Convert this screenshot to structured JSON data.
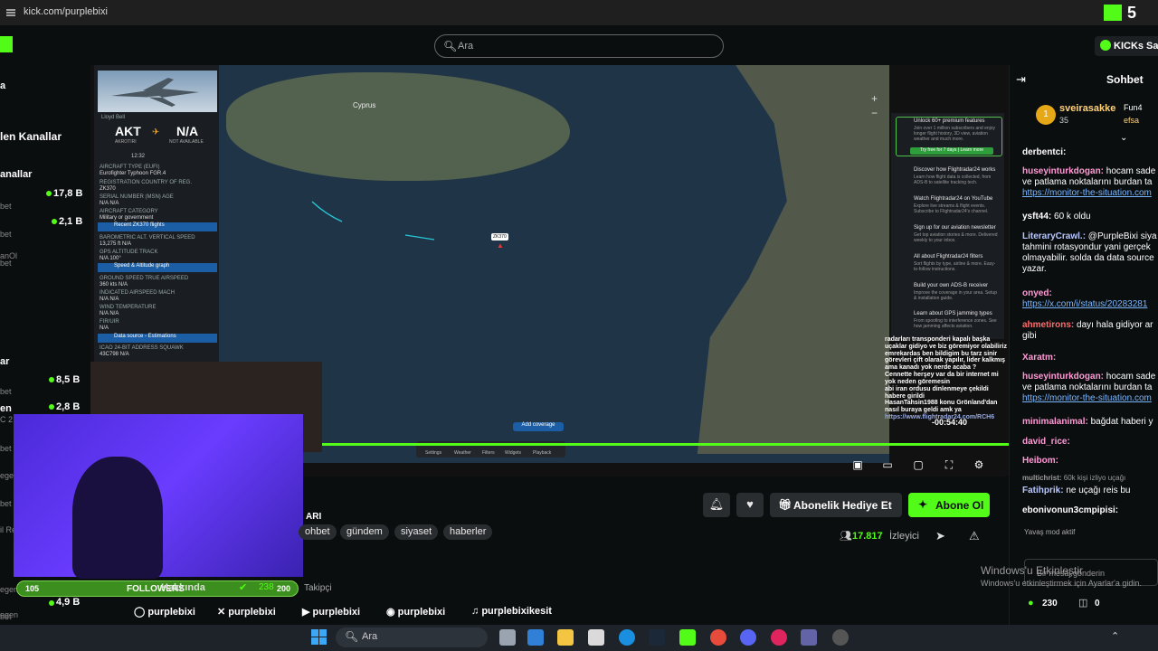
{
  "browser": {
    "url": "kick.com/purplebixi",
    "badge_count": "5"
  },
  "header": {
    "search_placeholder": "Ara",
    "kicks_button": "KICKs Sa"
  },
  "sidebar": {
    "sections": [
      "a",
      "len Kanallar",
      "anallar"
    ],
    "channels": [
      {
        "sub": "bet",
        "count": "17,8 B"
      },
      {
        "sub": "bet",
        "count": "2,1 B"
      },
      {
        "sub": "bet",
        "count": ""
      },
      {
        "sub": "anOl",
        "count": ""
      },
      {
        "sub": "bet",
        "count": "8,5 B"
      },
      {
        "sub": "bet",
        "count": "2,8 B"
      },
      {
        "sub": "bet",
        "count": "4,9 B"
      }
    ],
    "extra_labels": [
      "ar",
      "en",
      "C 2",
      "egen",
      "bet",
      "il Re",
      "egen",
      "egen"
    ]
  },
  "flight_panel": {
    "from": "AKT",
    "from_name": "AKROTIRI",
    "to": "N/A",
    "to_name": "NOT AVAILABLE",
    "aircraft_type": "Eurofighter Typhoon FGR.4",
    "rows": [
      "AIRCRAFT TYPE (EUFI)",
      "Eurofighter Typhoon FGR.4",
      "REGISTRATION   COUNTRY OF REG.",
      "ZK370",
      "SERIAL NUMBER (MSN)   AGE",
      "N/A   N/A",
      "AIRCRAFT CATEGORY",
      "Military or government"
    ],
    "sections": [
      "Recent ZK370 flights",
      "Speed & Altitude graph",
      "Data source - Estimations"
    ],
    "rows2": [
      "BAROMETRIC ALT.   VERTICAL SPEED",
      "13,275 ft   N/A",
      "GPS ALTITUDE   TRACK",
      "N/A   100°"
    ],
    "rows3": [
      "GROUND SPEED   TRUE AIRSPEED",
      "360 kts   N/A",
      "INDICATED AIRSPEED   MACH",
      "N/A   N/A",
      "WIND   TEMPERATURE",
      "N/A   N/A",
      "FIR/UIR",
      "N/A"
    ],
    "rows4": [
      "ICAO 24-BIT ADDRESS   SQUAWK",
      "43C798   N/A"
    ],
    "operator": "Lloyd Bell",
    "time": "12:32"
  },
  "map": {
    "place_cyprus": "Cyprus",
    "marker_label": "ZK370",
    "add_coverage": "Add coverage",
    "tools": [
      "Settings",
      "Weather",
      "Filters",
      "Widgets",
      "Playback"
    ],
    "right_panel": [
      {
        "title": "Unlock 60+ premium features",
        "line": "Join over 1 million subscribers and enjoy longer flight history, 3D view, aviation weather and much more."
      },
      {
        "title": "Try free for 7 days | Learn more",
        "line": ""
      },
      {
        "title": "Discover how Flightradar24 works",
        "line": "Learn how flight data is collected, from ADS-B to satellite tracking tech."
      },
      {
        "title": "Watch Flightradar24 on YouTube",
        "line": "Explore live streams & flight events. Subscribe to Flightradar24's channel."
      },
      {
        "title": "Sign up for our aviation newsletter",
        "line": "Get top aviation stories & more. Delivered weekly to your inbox."
      },
      {
        "title": "All about Flightradar24 filters",
        "line": "Sort flights by type, airline & more. Easy-to-follow instructions."
      },
      {
        "title": "Build your own ADS-B receiver",
        "line": "Improve the coverage in your area. Setup & installation guide."
      },
      {
        "title": "Learn about GPS jamming types",
        "line": "From spoofing to interference zones. See how jamming affects aviation."
      }
    ]
  },
  "stream_overlay": {
    "chat_lines": [
      "radarları transponderi kapalı başka uçaklar gidiyo ve biz göremiyor olabiliriz",
      "emrekardas  ben bildigim bu tarz sinir görevleri çift olarak yapılır, lider kalkmış ama kanadı yok nerde acaba ?",
      "Cennette herşey var da bir internet mi yok neden göremesin",
      "abi iran ordusu dinlenmeye çekildi habere girildi",
      "HasanTahsin1988  konu Grönland'dan nasıl buraya geldi amk ya",
      "https://www.flightradar24.com/RCH6"
    ],
    "timer": "-00:54:40"
  },
  "webcam": {
    "followers_current": "105",
    "followers_label": "FOLLOWERS",
    "followers_goal": "200"
  },
  "stream_info": {
    "title_fragment": "ARI",
    "tags": [
      "ohbet",
      "gündem",
      "siyaset",
      "haberler"
    ],
    "gift_label": "Abonelik Hediye Et",
    "subscribe_label": "Abone Ol",
    "viewers": "17.817",
    "viewers_label": "İzleyici",
    "about_label": "Hakkında",
    "follower_count": "238",
    "follower_label": "Takipçi",
    "socials": [
      "purplebixi",
      "purplebixi",
      "purplebixi",
      "purplebixi",
      "purplebixikesit"
    ]
  },
  "chat": {
    "title": "Sohbet",
    "pinned_user": "sveirasakke",
    "pinned_count": "35",
    "pinned_extra": [
      "Fun4",
      "efsa"
    ],
    "messages": [
      {
        "user": "derbentci:",
        "text": "",
        "color": "#ffffff"
      },
      {
        "user": "huseyinturkdogan:",
        "text": " hocam sade ve patlama noktalarını burdan ta",
        "link": "https://monitor-the-situation.com",
        "color": "#ff9ad5"
      },
      {
        "user": "ysft44:",
        "text": " 60 k oldu",
        "color": "#ffffff"
      },
      {
        "user": "LiteraryCrawl.:",
        "text": " @PurpleBixi siya tahmini rotasyondur yani gerçek olmayabilir. solda da data source yazar.",
        "color": "#b8c7ff"
      },
      {
        "user": "onyed:",
        "text": "",
        "link": "https://x.com/i/status/20283281",
        "color": "#ff9ad5"
      },
      {
        "user": "ahmetirons:",
        "text": " dayı hala gidiyor ar gibi",
        "color": "#ff6b6b"
      },
      {
        "user": "Xaratm:",
        "text": "",
        "color": "#ff9ad5"
      },
      {
        "user": "huseyinturkdogan:",
        "text": " hocam sade ve patlama noktalarını burdan ta",
        "link": "https://monitor-the-situation.com",
        "color": "#ff9ad5"
      },
      {
        "user": "minimalanimal:",
        "text": " bağdat haberi y",
        "color": "#ff9ad5"
      },
      {
        "user": "david_rice:",
        "text": "",
        "color": "#ff9ad5"
      },
      {
        "user": "Heibom:",
        "text": "",
        "color": "#ff9ad5"
      },
      {
        "user": "multichrist:",
        "text": " 60k kişi izliyo uçağı",
        "color": "#9a9a9a"
      },
      {
        "user": "Fatihprik:",
        "text": " ne uçağı reis bu",
        "color": "#b8c7ff"
      },
      {
        "user": "ebonivonun3cmpipisi:",
        "text": "",
        "color": "#ffffff"
      }
    ],
    "slow_mode": "Yavaş mod aktif",
    "input_placeholder": "Bir mesaj gönderin",
    "kicks_balance": "230",
    "rewards_balance": "0"
  },
  "windows": {
    "activate_title": "Windows'u Etkinleştir",
    "activate_sub": "Windows'u etkinleştirmek için Ayarlar'a gidin.",
    "taskbar_search": "Ara"
  },
  "colors": {
    "accent": "#53fc18",
    "background": "#0b0e0f",
    "panel": "#2a2d30"
  }
}
